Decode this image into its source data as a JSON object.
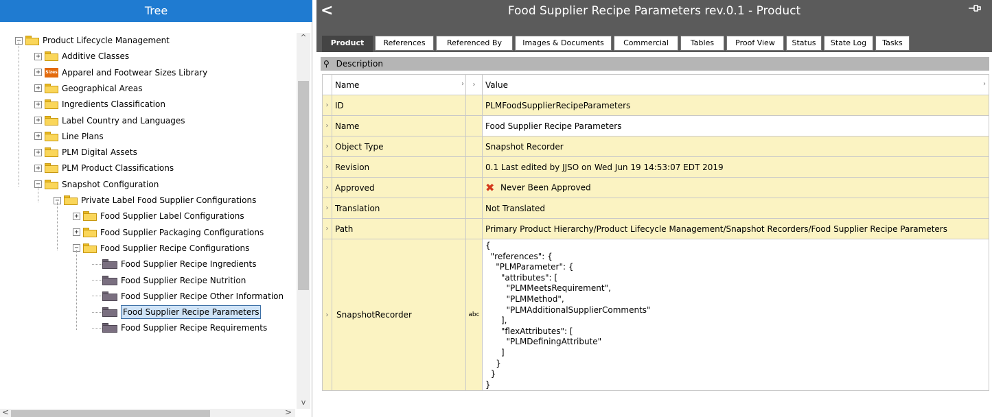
{
  "tree": {
    "header": "Tree",
    "items": [
      {
        "label": "Product Lifecycle Management",
        "level": 0,
        "exp": "−",
        "icon": "folder"
      },
      {
        "label": "Additive Classes",
        "level": 1,
        "exp": "+",
        "icon": "folder"
      },
      {
        "label": "Apparel and Footwear Sizes Library",
        "level": 1,
        "exp": "+",
        "icon": "sizes",
        "icon_text": "Sizes"
      },
      {
        "label": "Geographical Areas",
        "level": 1,
        "exp": "+",
        "icon": "folder"
      },
      {
        "label": "Ingredients Classification",
        "level": 1,
        "exp": "+",
        "icon": "folder"
      },
      {
        "label": "Label Country and Languages",
        "level": 1,
        "exp": "+",
        "icon": "folder"
      },
      {
        "label": "Line Plans",
        "level": 1,
        "exp": "+",
        "icon": "folder"
      },
      {
        "label": "PLM Digital Assets",
        "level": 1,
        "exp": "+",
        "icon": "folder"
      },
      {
        "label": "PLM Product Classifications",
        "level": 1,
        "exp": "+",
        "icon": "folder"
      },
      {
        "label": "Snapshot Configuration",
        "level": 1,
        "exp": "−",
        "icon": "folder"
      },
      {
        "label": "Private Label Food Supplier Configurations",
        "level": 2,
        "exp": "−",
        "icon": "folder"
      },
      {
        "label": "Food Supplier Label Configurations",
        "level": 3,
        "exp": "+",
        "icon": "folder"
      },
      {
        "label": "Food Supplier Packaging Configurations",
        "level": 3,
        "exp": "+",
        "icon": "folder"
      },
      {
        "label": "Food Supplier Recipe Configurations",
        "level": 3,
        "exp": "−",
        "icon": "folder"
      },
      {
        "label": "Food Supplier Recipe Ingredients",
        "level": 4,
        "exp": "",
        "icon": "leaf"
      },
      {
        "label": "Food Supplier Recipe Nutrition",
        "level": 4,
        "exp": "",
        "icon": "leaf"
      },
      {
        "label": "Food Supplier Recipe Other Information",
        "level": 4,
        "exp": "",
        "icon": "leaf"
      },
      {
        "label": "Food Supplier Recipe Parameters",
        "level": 4,
        "exp": "",
        "icon": "leaf",
        "selected": true
      },
      {
        "label": "Food Supplier Recipe Requirements",
        "level": 4,
        "exp": "",
        "icon": "leaf"
      }
    ],
    "scroll_up": "^",
    "scroll_down": "v",
    "scroll_left": "<",
    "scroll_right": ">"
  },
  "title_bar": {
    "back": "<",
    "title": "Food Supplier Recipe Parameters rev.0.1 - Product",
    "pin_icon": "pin-icon"
  },
  "tabs": [
    {
      "label": "Product",
      "active": true
    },
    {
      "label": "References"
    },
    {
      "label": "Referenced By"
    },
    {
      "label": "Images & Documents"
    },
    {
      "label": "Commercial"
    },
    {
      "label": "Tables"
    },
    {
      "label": "Proof View"
    },
    {
      "label": "Status"
    },
    {
      "label": "State Log"
    },
    {
      "label": "Tasks"
    }
  ],
  "section": {
    "pin": "⚲",
    "title": "Description"
  },
  "table": {
    "col_name": "Name",
    "col_value": "Value",
    "rows": [
      {
        "name": "ID",
        "value": "PLMFoodSupplierRecipeParameters"
      },
      {
        "name": "Name",
        "value": "Food Supplier Recipe Parameters",
        "white": true
      },
      {
        "name": "Object Type",
        "value": "Snapshot Recorder"
      },
      {
        "name": "Revision",
        "value": "0.1 Last edited by JJSO on Wed Jun 19 14:53:07 EDT 2019"
      },
      {
        "name": "Approved",
        "value": "Never Been Approved",
        "icon": "x-icon"
      },
      {
        "name": "Translation",
        "value": "Not Translated"
      },
      {
        "name": "Path",
        "value": "Primary Product Hierarchy/Product Lifecycle Management/Snapshot Recorders/Food Supplier Recipe Parameters"
      }
    ],
    "snapshot": {
      "name": "SnapshotRecorder",
      "type": "abc",
      "value": "{\n  \"references\": {\n    \"PLMParameter\": {\n      \"attributes\": [\n        \"PLMMeetsRequirement\",\n        \"PLMMethod\",\n        \"PLMAdditionalSupplierComments\"\n      ],\n      \"flexAttributes\": [\n        \"PLMDefiningAttribute\"\n      ]\n    }\n  }\n}"
    }
  }
}
